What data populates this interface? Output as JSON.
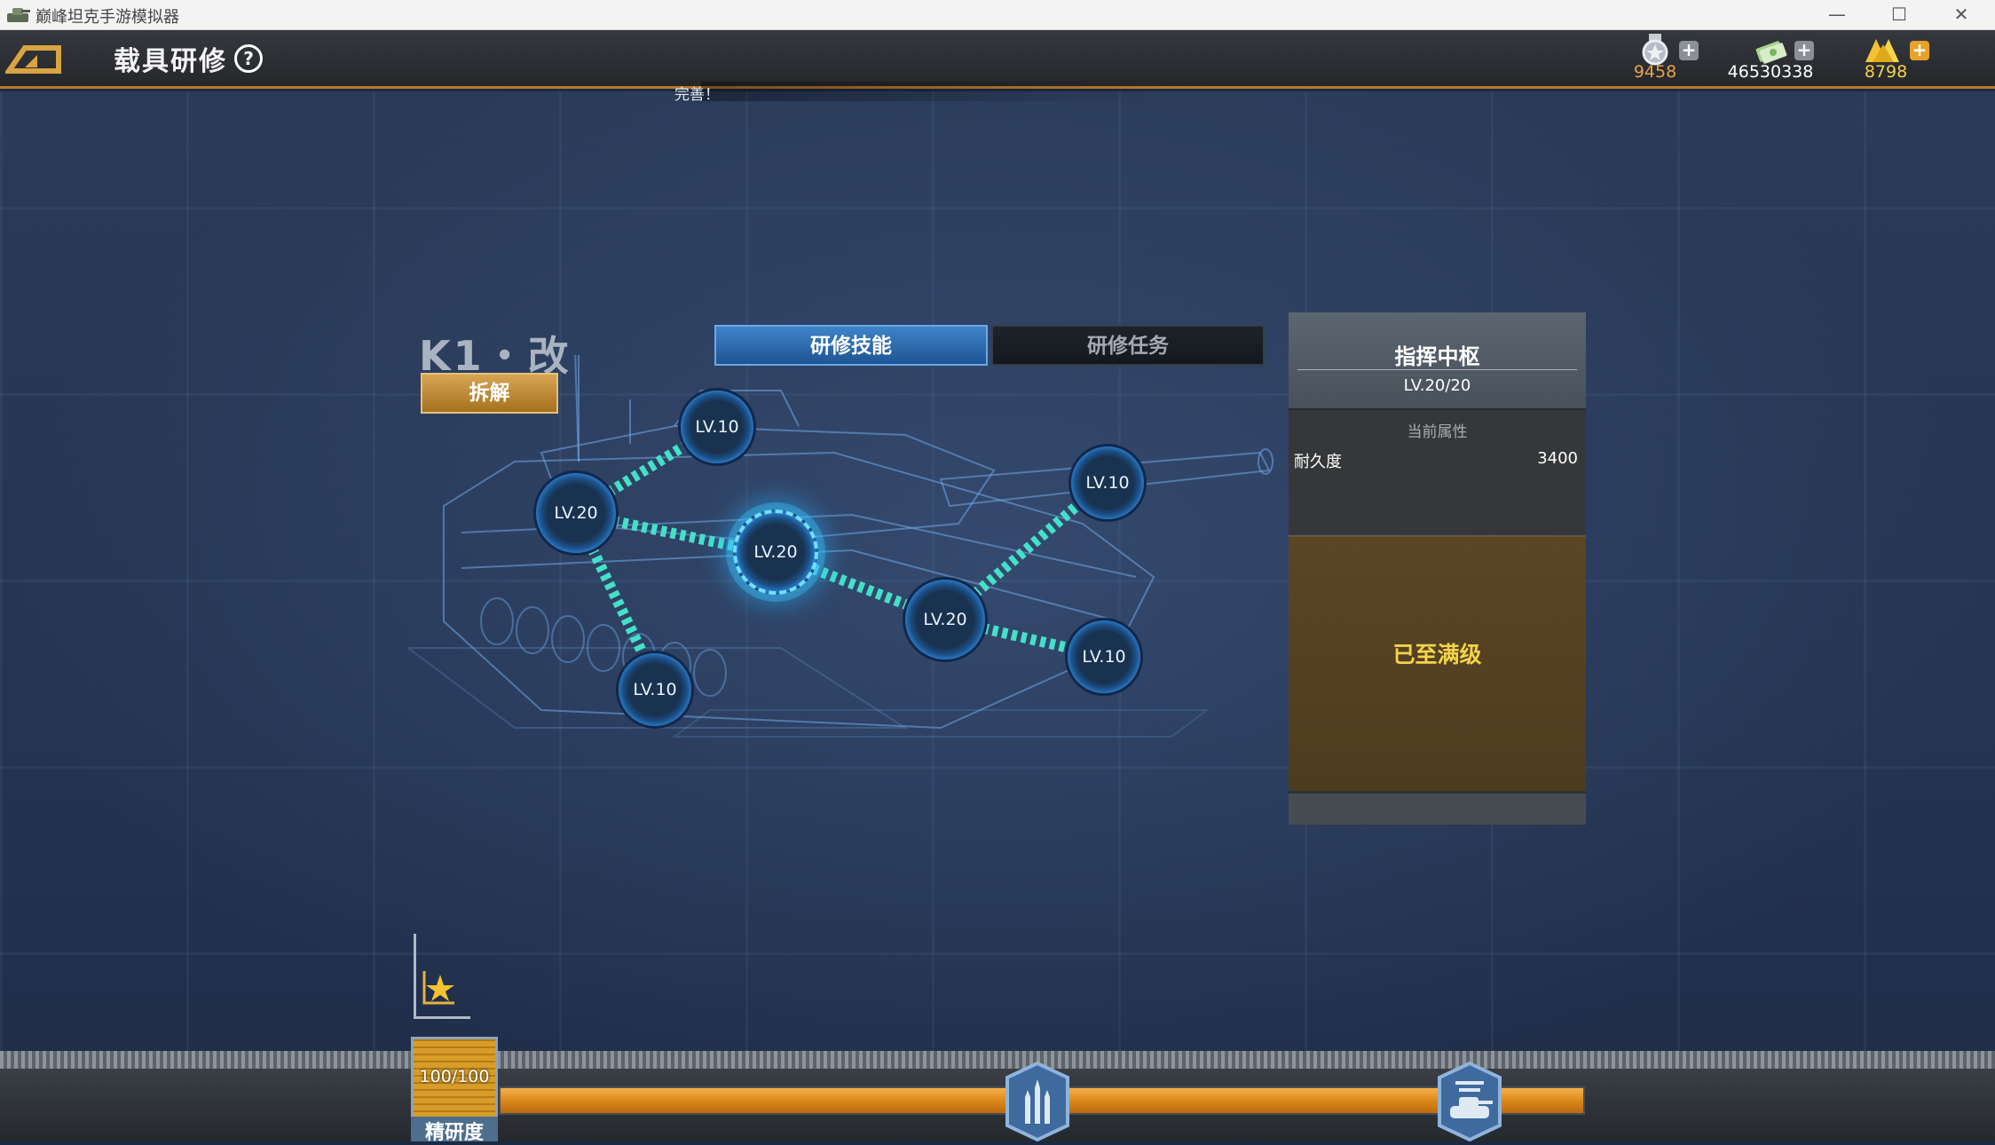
{
  "window": {
    "title": "巅峰坦克手游模拟器",
    "minimize": "—",
    "maximize": "☐",
    "close": "✕"
  },
  "header": {
    "page_title": "载具研修",
    "help_glyph": "?",
    "currencies": [
      {
        "icon": "medal-icon",
        "value": "9458",
        "color": "#e8a34a"
      },
      {
        "icon": "cash-icon",
        "value": "46530338",
        "color": "#ffffff"
      },
      {
        "icon": "gold-icon",
        "value": "8798",
        "color": "#f2d24a"
      }
    ],
    "plus_glyph": "+"
  },
  "toast": "完善！",
  "tank": {
    "name": "K1・改",
    "dismantle_label": "拆解"
  },
  "tabs": [
    {
      "label": "研修技能",
      "active": true
    },
    {
      "label": "研修任务",
      "active": false
    }
  ],
  "skill_nodes": [
    {
      "label": "LV.10"
    },
    {
      "label": "LV.20"
    },
    {
      "label": "LV.20",
      "selected": true
    },
    {
      "label": "LV.10"
    },
    {
      "label": "LV.20"
    },
    {
      "label": "LV.10"
    },
    {
      "label": "LV.10"
    }
  ],
  "panel": {
    "title": "指挥中枢",
    "level": "LV.20/20",
    "attr_header": "当前属性",
    "attr_name": "耐久度",
    "attr_value": "3400",
    "max_label": "已至满级"
  },
  "precision": {
    "value": "100/100",
    "label": "精研度",
    "progress": 1.0
  },
  "colors": {
    "accent_orange": "#d98518",
    "highlight_cyan": "#44e0c8",
    "max_yellow": "#f3d34a"
  }
}
